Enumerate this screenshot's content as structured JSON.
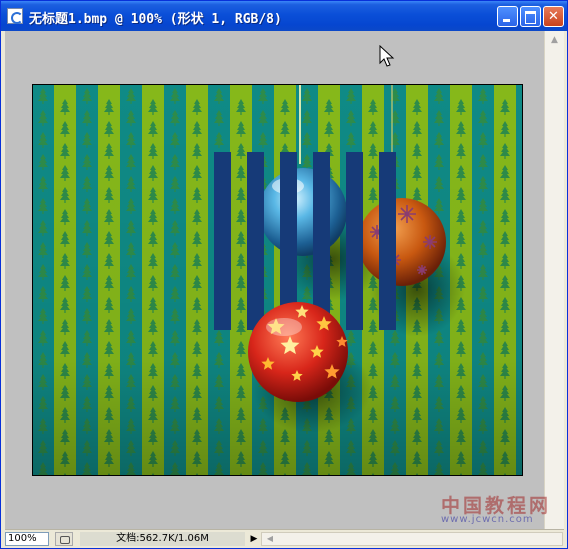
{
  "window": {
    "title": "无标题1.bmp @ 100% (形状 1, RGB/8)",
    "icon": "photoshop-document-icon",
    "controls": [
      "minimize-icon",
      "maximize-icon",
      "close-icon"
    ]
  },
  "colors": {
    "titlebar": "#0a4fd8",
    "canvas_bg": "#c0c0c0",
    "stripe_teal": "#0f8a86",
    "stripe_green": "#86b81a",
    "tree": "#2e8c4a",
    "bars": "#163a78",
    "blue_ball": "#4aa8d8",
    "orange_ball": "#d66a1a",
    "red_ball": "#d8281c"
  },
  "status": {
    "zoom": "100%",
    "doc_size": "文档:562.7K/1.06M"
  },
  "watermark": {
    "cn": "中国教程网",
    "url": "www.jcwcn.com"
  }
}
